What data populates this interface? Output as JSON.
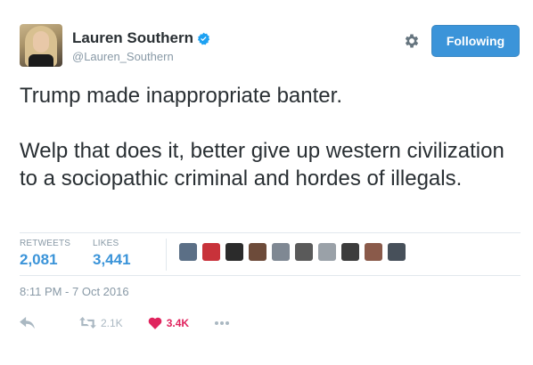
{
  "user": {
    "display_name": "Lauren Southern",
    "handle": "@Lauren_Southern"
  },
  "follow_button": {
    "label": "Following"
  },
  "tweet": {
    "paragraphs": [
      "Trump made inappropriate banter.",
      "Welp that does it, better give up western civilization to a sociopathic criminal and hordes of illegals."
    ],
    "timestamp": "8:11 PM - 7 Oct 2016"
  },
  "stats": {
    "retweets": {
      "label": "RETWEETS",
      "value": "2,081"
    },
    "likes": {
      "label": "LIKES",
      "value": "3,441"
    }
  },
  "likers": [
    {
      "name": "liker-avatar-1",
      "color": "#5b6f86"
    },
    {
      "name": "liker-avatar-2",
      "color": "#c8323a"
    },
    {
      "name": "liker-avatar-3",
      "color": "#2b2b2b"
    },
    {
      "name": "liker-avatar-4",
      "color": "#6d4b3a"
    },
    {
      "name": "liker-avatar-5",
      "color": "#7f8893"
    },
    {
      "name": "liker-avatar-6",
      "color": "#5a5a5a"
    },
    {
      "name": "liker-avatar-7",
      "color": "#9aa1a8"
    },
    {
      "name": "liker-avatar-8",
      "color": "#3c3c3c"
    },
    {
      "name": "liker-avatar-9",
      "color": "#8a5a4a"
    },
    {
      "name": "liker-avatar-10",
      "color": "#47505a"
    }
  ],
  "actions": {
    "reply": {
      "icon": "reply-icon"
    },
    "retweet": {
      "icon": "retweet-icon",
      "count": "2.1K"
    },
    "like": {
      "icon": "heart-icon",
      "count": "3.4K"
    },
    "more": {
      "icon": "more-dots-icon"
    }
  },
  "colors": {
    "accent": "#3b94d9",
    "like_red": "#e0245e",
    "muted": "#8899a6",
    "text": "#292f33",
    "verified_blue": "#1da1f2"
  }
}
